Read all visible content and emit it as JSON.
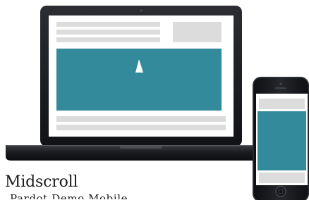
{
  "caption": {
    "title": "Midscroll",
    "subtitle": "Pardot Demo Mobile"
  },
  "colors": {
    "teal_panel": "#338a9b",
    "placeholder_gray": "#dcdcdc",
    "device_dark": "#1a1c21",
    "screen_white": "#ffffff"
  },
  "icons": {
    "play": "up-triangle-icon"
  }
}
